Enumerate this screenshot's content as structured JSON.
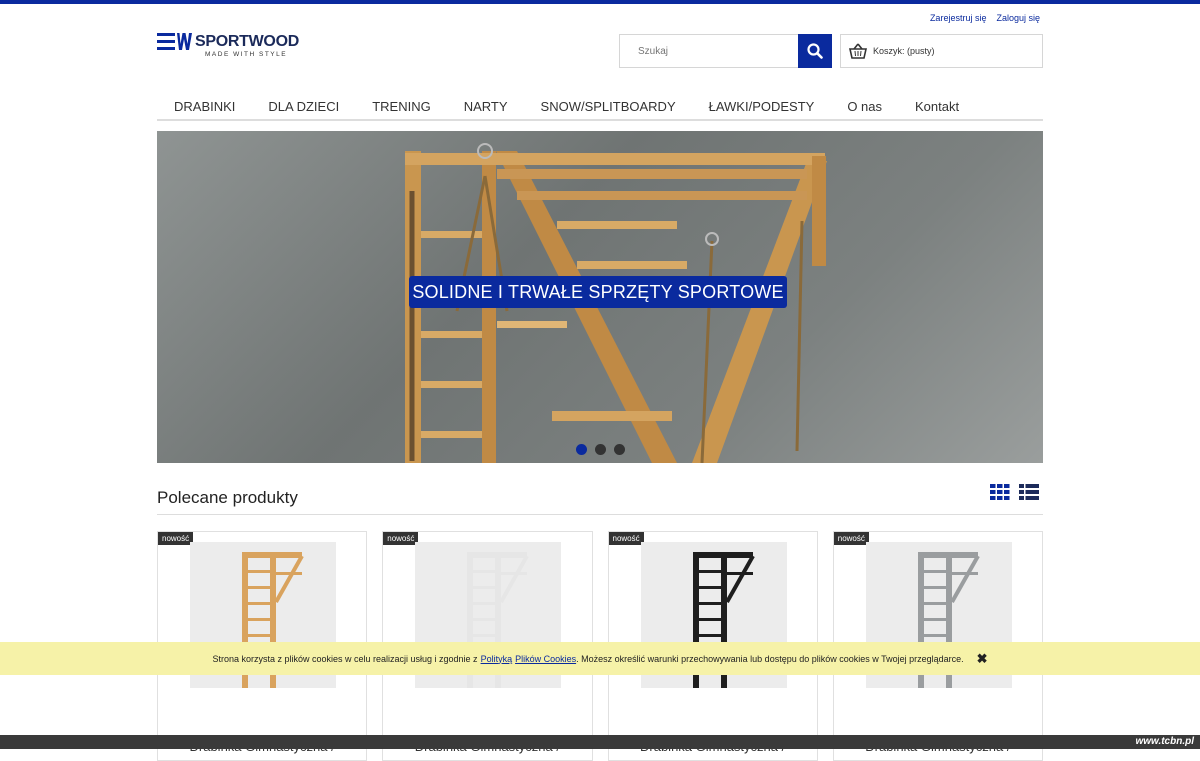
{
  "header": {
    "register_label": "Zarejestruj się",
    "login_label": "Zaloguj się",
    "logo_name": "SPORTWOOD",
    "logo_tagline": "MADE WITH STYLE",
    "search_placeholder": "Szukaj",
    "cart_label": "Koszyk: (pusty)"
  },
  "nav": {
    "items": [
      "DRABINKI",
      "DLA DZIECI",
      "TRENING",
      "NARTY",
      "SNOW/SPLITBOARDY",
      "ŁAWKI/PODESTY",
      "O nas",
      "Kontakt"
    ]
  },
  "hero": {
    "banner_text": "SOLIDNE I TRWAŁE  SPRZĘTY SPORTOWE",
    "slides_count": 3,
    "active_slide": 1
  },
  "featured": {
    "title": "Polecane produkty",
    "products": [
      {
        "badge": "nowość",
        "title": "Drabinka Gimnastyczna /",
        "color": "#d9a35e"
      },
      {
        "badge": "nowość",
        "title": "Drabinka Gimnastyczna /",
        "color": "#e6e6e6"
      },
      {
        "badge": "nowość",
        "title": "Drabinka Gimnastyczna /",
        "color": "#1e1e1e"
      },
      {
        "badge": "nowość",
        "title": "Drabinka Gimnastyczna /",
        "color": "#9a9d9f"
      }
    ]
  },
  "cookie": {
    "text_before": "Strona korzysta z plików cookies w celu realizacji usług i zgodnie z",
    "link1": "Polityką",
    "link2": "Plików Cookies",
    "text_after": ". Możesz określić warunki przechowywania lub dostępu do plików cookies w Twojej przeglądarce."
  },
  "watermark": "www.tcbn.pl",
  "colors": {
    "accent": "#0a2a9e",
    "cookie_bg": "#f6f2a8"
  }
}
